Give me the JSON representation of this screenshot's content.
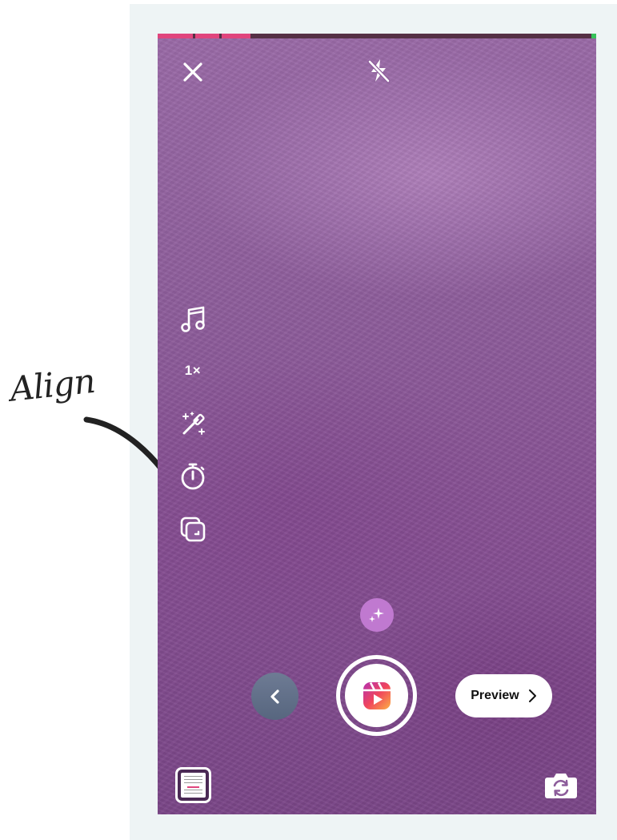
{
  "annotation": {
    "label": "Align"
  },
  "camera": {
    "progress_segments": 3,
    "tools": {
      "speed_label": "1×"
    },
    "preview_label": "Preview"
  },
  "icons": {
    "close": "close-icon",
    "flash": "flash-off-icon",
    "audio": "music-note-icon",
    "speed": "speed-icon",
    "effects": "magic-wand-icon",
    "timer": "timer-icon",
    "align": "align-icon",
    "sparkles": "sparkles-icon",
    "back": "chevron-left-icon",
    "shutter": "reels-icon",
    "preview_chevron": "chevron-right-icon",
    "gallery": "gallery-thumbnail-icon",
    "flip": "flip-camera-icon"
  },
  "colors": {
    "background": "#8d5d9b",
    "progress_active": "#e0457d",
    "effects_button": "#c079d0",
    "back_button": "#5f6d86"
  }
}
